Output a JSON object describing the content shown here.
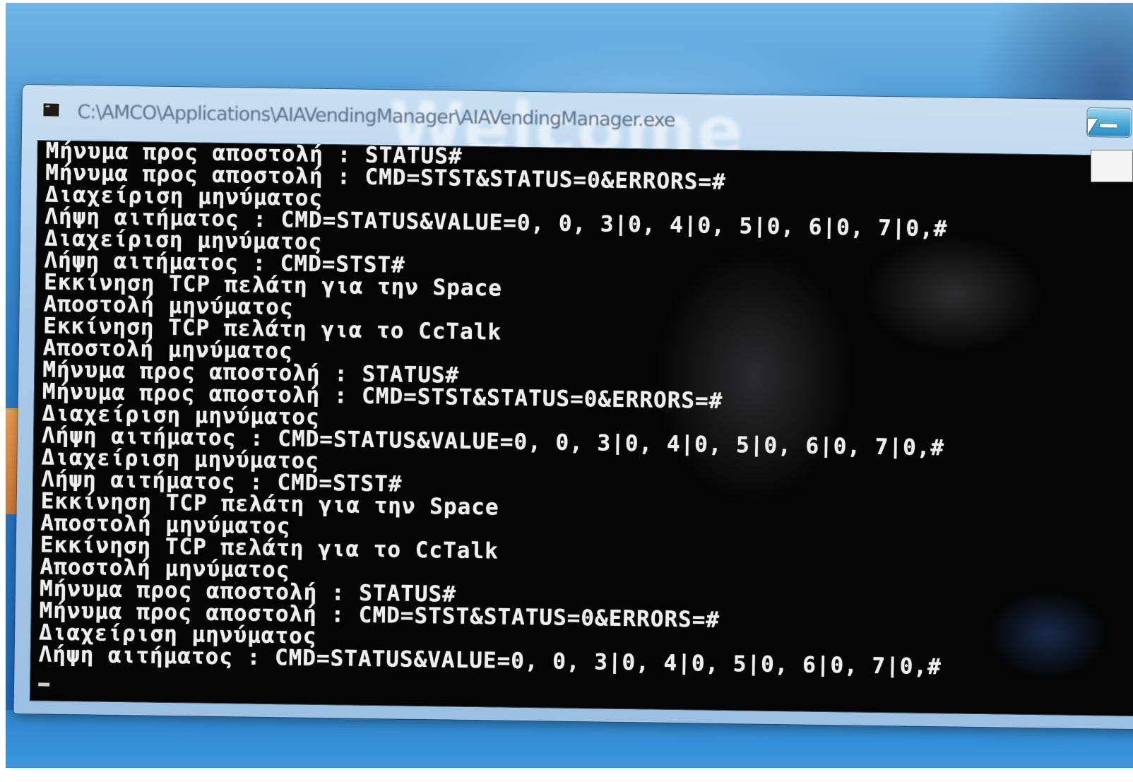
{
  "window": {
    "title": "C:\\AMCO\\Applications\\AIAVendingManager\\AIAVendingManager.exe",
    "background_watermark": "Welcome"
  },
  "console": {
    "lines": [
      "Μήνυμα προς αποστολή : STATUS#",
      "Μήνυμα προς αποστολή : CMD=STST&STATUS=0&ERRORS=#",
      "Διαχείριση μηνύματος",
      "Λήψη αιτήματος : CMD=STATUS&VALUE=0, 0, 3|0, 4|0, 5|0, 6|0, 7|0,#",
      "Διαχείριση μηνύματος",
      "Λήψη αιτήματος : CMD=STST#",
      "Εκκίνηση TCP πελάτη για την Space",
      "Αποστολή μηνύματος",
      "Εκκίνηση TCP πελάτη για το CcTalk",
      "Αποστολή μηνύματος",
      "Μήνυμα προς αποστολή : STATUS#",
      "Μήνυμα προς αποστολή : CMD=STST&STATUS=0&ERRORS=#",
      "Διαχείριση μηνύματος",
      "Λήψη αιτήματος : CMD=STATUS&VALUE=0, 0, 3|0, 4|0, 5|0, 6|0, 7|0,#",
      "Διαχείριση μηνύματος",
      "Λήψη αιτήματος : CMD=STST#",
      "Εκκίνηση TCP πελάτη για την Space",
      "Αποστολή μηνύματος",
      "Εκκίνηση TCP πελάτη για το CcTalk",
      "Αποστολή μηνύματος",
      "Μήνυμα προς αποστολή : STATUS#",
      "Μήνυμα προς αποστολή : CMD=STST&STATUS=0&ERRORS=#",
      "Διαχείριση μηνύματος",
      "Λήψη αιτήματος : CMD=STATUS&VALUE=0, 0, 3|0, 4|0, 5|0, 6|0, 7|0,#"
    ]
  },
  "icons": {
    "window_icon": "console-app-icon",
    "minimize": "minimize-icon",
    "pointer": "mouse-pointer-icon"
  },
  "colors": {
    "console_background": "#050505",
    "console_text": "#eeeeee",
    "titlebar": "#a9c9e6",
    "desktop": "#2a76c2"
  }
}
